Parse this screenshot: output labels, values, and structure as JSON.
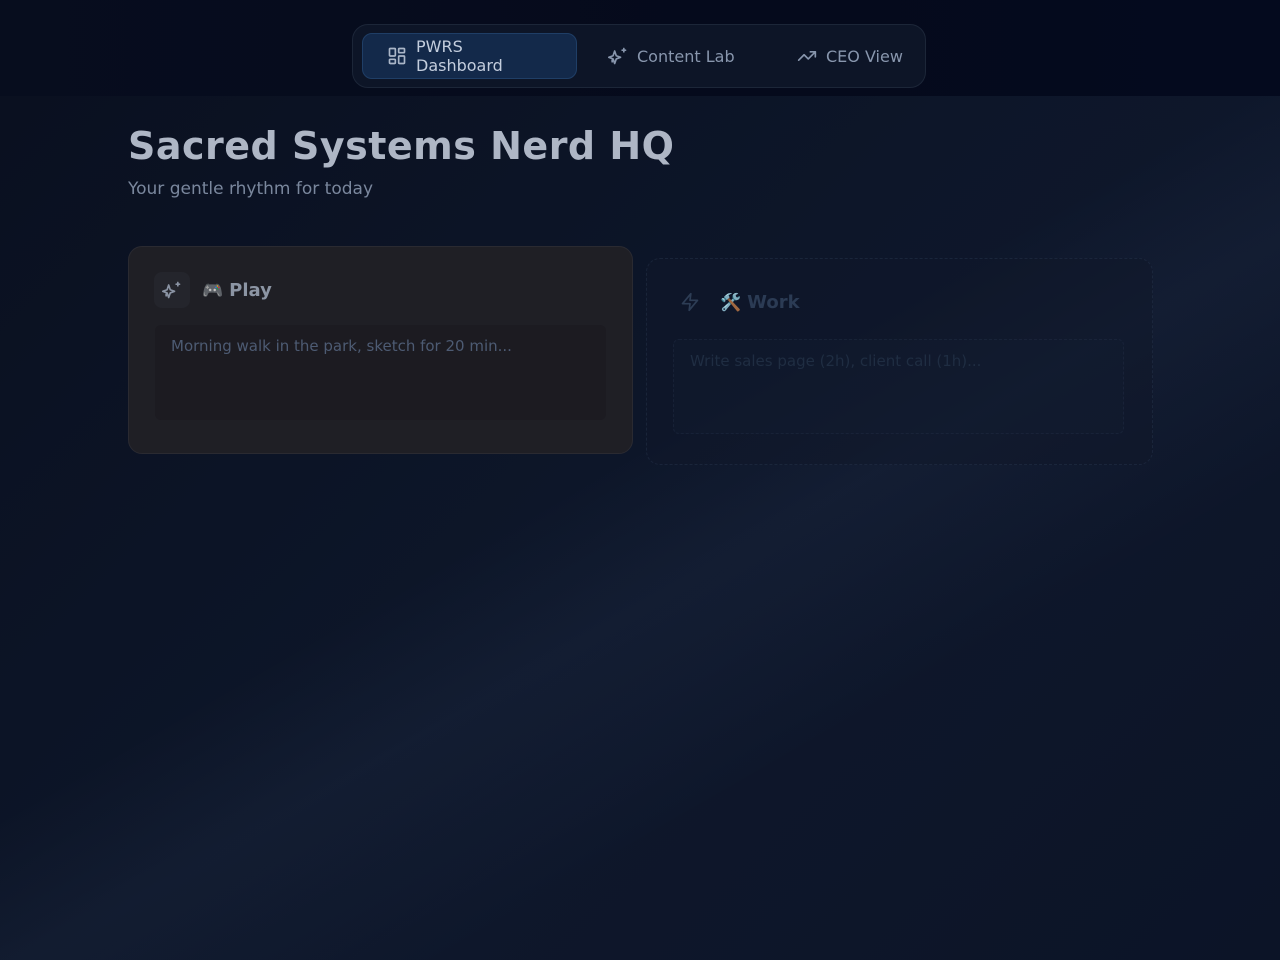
{
  "nav": {
    "tabs": [
      {
        "label": "PWRS Dashboard",
        "icon": "dashboard-grid-icon",
        "active": true
      },
      {
        "label": "Content Lab",
        "icon": "sparkles-icon",
        "active": false
      },
      {
        "label": "CEO View",
        "icon": "trending-up-icon",
        "active": false
      }
    ]
  },
  "header": {
    "title": "Sacred Systems Nerd HQ",
    "subtitle": "Your gentle rhythm for today"
  },
  "cards": [
    {
      "key": "play",
      "emoji": "🎮",
      "title": "Play",
      "icon": "sparkles-icon",
      "placeholder": "Morning walk in the park, sketch for 20 min..."
    },
    {
      "key": "work",
      "emoji": "🛠️",
      "title": "Work",
      "icon": "lightning-icon",
      "placeholder": "Write sales page (2h), client call (1h)..."
    }
  ],
  "colors": {
    "background": "#0b1222",
    "nav_active": "#13294a",
    "play_card": "#1f1f25",
    "title_text": "#aeb6c5"
  }
}
